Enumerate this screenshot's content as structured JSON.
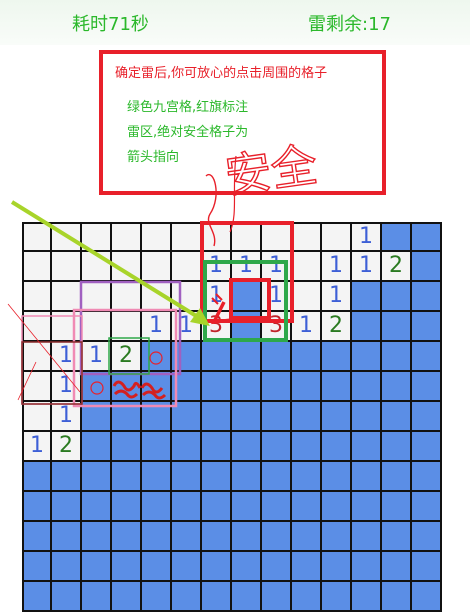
{
  "header": {
    "time_label": "耗时71秒",
    "mines_label": "雷剩余:17"
  },
  "tip": {
    "line1": "确定雷后,你可放心的点击周围的格子",
    "line2": "绿色九宫格,红旗标注",
    "line3": "雷区,绝对安全格子为",
    "line4": "箭头指向"
  },
  "annotation": {
    "handwritten_text": "安全"
  },
  "colors": {
    "open_cell": "#f4f4f4",
    "closed_cell": "#5b8ee6",
    "number_1": "#3d5fd6",
    "number_2": "#2a7a20",
    "number_3": "#c0232a",
    "title_green": "#2bb82b",
    "tip_red": "#e8202a"
  },
  "board": {
    "cols": 14,
    "rows": [
      [
        "",
        "",
        "",
        "",
        "",
        "",
        "",
        "",
        "",
        "",
        "",
        "1",
        "#",
        "#"
      ],
      [
        "",
        "",
        "",
        "",
        "",
        "",
        "1",
        "1",
        "1",
        "",
        "1",
        "1",
        "2",
        "#"
      ],
      [
        "",
        "",
        "",
        "",
        "",
        "",
        "1",
        "#",
        "1",
        "",
        "1",
        "#",
        "#",
        "#"
      ],
      [
        "",
        "",
        "",
        "",
        "1",
        "1",
        "3",
        "#",
        "3",
        "1",
        "2",
        "#",
        "#",
        "#"
      ],
      [
        "",
        "1",
        "1",
        "2",
        "#",
        "#",
        "#",
        "#",
        "#",
        "#",
        "#",
        "#",
        "#",
        "#"
      ],
      [
        "",
        "1",
        "#",
        "#",
        "#",
        "#",
        "#",
        "#",
        "#",
        "#",
        "#",
        "#",
        "#",
        "#"
      ],
      [
        "",
        "1",
        "#",
        "#",
        "#",
        "#",
        "#",
        "#",
        "#",
        "#",
        "#",
        "#",
        "#",
        "#"
      ],
      [
        "1",
        "2",
        "#",
        "#",
        "#",
        "#",
        "#",
        "#",
        "#",
        "#",
        "#",
        "#",
        "#",
        "#"
      ],
      [
        "#",
        "#",
        "#",
        "#",
        "#",
        "#",
        "#",
        "#",
        "#",
        "#",
        "#",
        "#",
        "#",
        "#"
      ],
      [
        "#",
        "#",
        "#",
        "#",
        "#",
        "#",
        "#",
        "#",
        "#",
        "#",
        "#",
        "#",
        "#",
        "#"
      ],
      [
        "#",
        "#",
        "#",
        "#",
        "#",
        "#",
        "#",
        "#",
        "#",
        "#",
        "#",
        "#",
        "#",
        "#"
      ],
      [
        "#",
        "#",
        "#",
        "#",
        "#",
        "#",
        "#",
        "#",
        "#",
        "#",
        "#",
        "#",
        "#",
        "#"
      ],
      [
        "#",
        "#",
        "#",
        "#",
        "#",
        "#",
        "#",
        "#",
        "#",
        "#",
        "#",
        "#",
        "#",
        "#"
      ]
    ]
  }
}
